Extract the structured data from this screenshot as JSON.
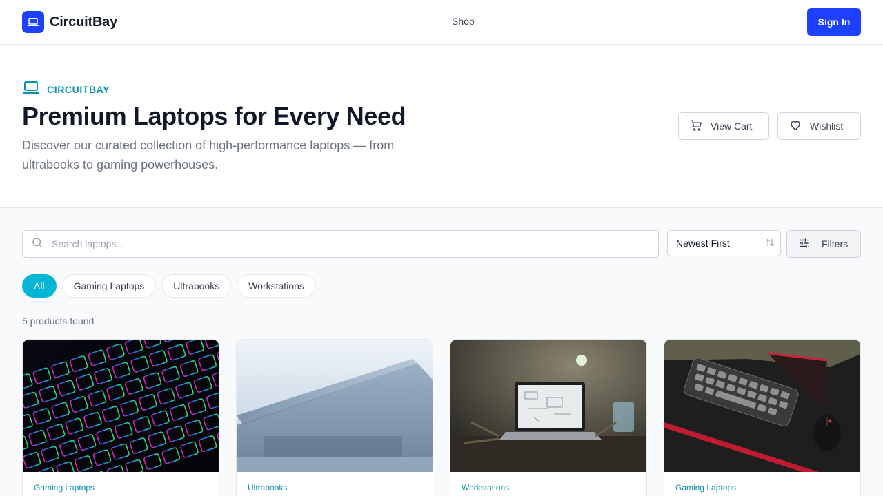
{
  "header": {
    "brand": "CircuitBay",
    "nav": [
      {
        "label": "Shop"
      }
    ],
    "signin_label": "Sign In",
    "accent_color": "#1e40ff"
  },
  "hero": {
    "eyebrow": "CIRCUITBAY",
    "title": "Premium Laptops for Every Need",
    "subtitle": "Discover our curated collection of high-performance laptops — from ultrabooks to gaming powerhouses.",
    "view_cart_label": "View Cart",
    "wishlist_label": "Wishlist",
    "eyebrow_color": "#0891b2"
  },
  "toolbar": {
    "search_placeholder": "Search laptops...",
    "sort_value": "Newest First",
    "filters_label": "Filters"
  },
  "categories": [
    {
      "label": "All",
      "active": true
    },
    {
      "label": "Gaming Laptops",
      "active": false
    },
    {
      "label": "Ultrabooks",
      "active": false
    },
    {
      "label": "Workstations",
      "active": false
    }
  ],
  "results": {
    "count_text": "5 products found"
  },
  "products": [
    {
      "category": "Gaming Laptops",
      "image": "rgb backlit gaming keyboard"
    },
    {
      "category": "Ultrabooks",
      "image": "silver ultrabook lid"
    },
    {
      "category": "Workstations",
      "image": "laptop on workbench"
    },
    {
      "category": "Gaming Laptops",
      "image": "keyboard and mouse on desk"
    }
  ]
}
